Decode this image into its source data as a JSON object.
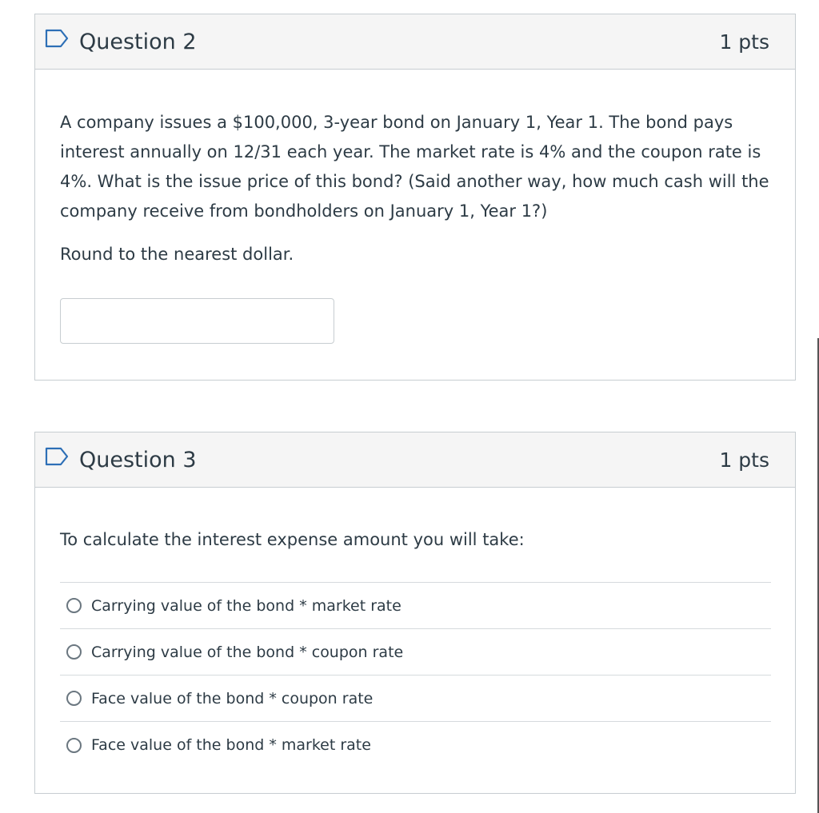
{
  "questions": [
    {
      "title": "Question 2",
      "points": "1 pts",
      "text": "A company issues a $100,000, 3-year bond on January 1, Year 1. The bond pays interest annually on 12/31 each year. The market rate is 4% and the coupon rate is 4%. What is the issue price of this bond? (Said another way, how much cash will the company receive from bondholders on January 1, Year 1?)",
      "instruction": "Round to the nearest dollar.",
      "answer_value": "",
      "icon": "flag-icon"
    },
    {
      "title": "Question 3",
      "points": "1 pts",
      "text": "To calculate the interest expense amount you will take:",
      "icon": "flag-icon",
      "options": [
        "Carrying value of the bond * market rate",
        "Carrying value of the bond * coupon rate",
        "Face value of the bond * coupon rate",
        "Face value of the bond * market rate"
      ]
    }
  ],
  "colors": {
    "header_bg": "#f5f5f5",
    "border": "#c7cdd1",
    "flag_icon": "#2d6fb6",
    "text": "#2d3b45"
  }
}
